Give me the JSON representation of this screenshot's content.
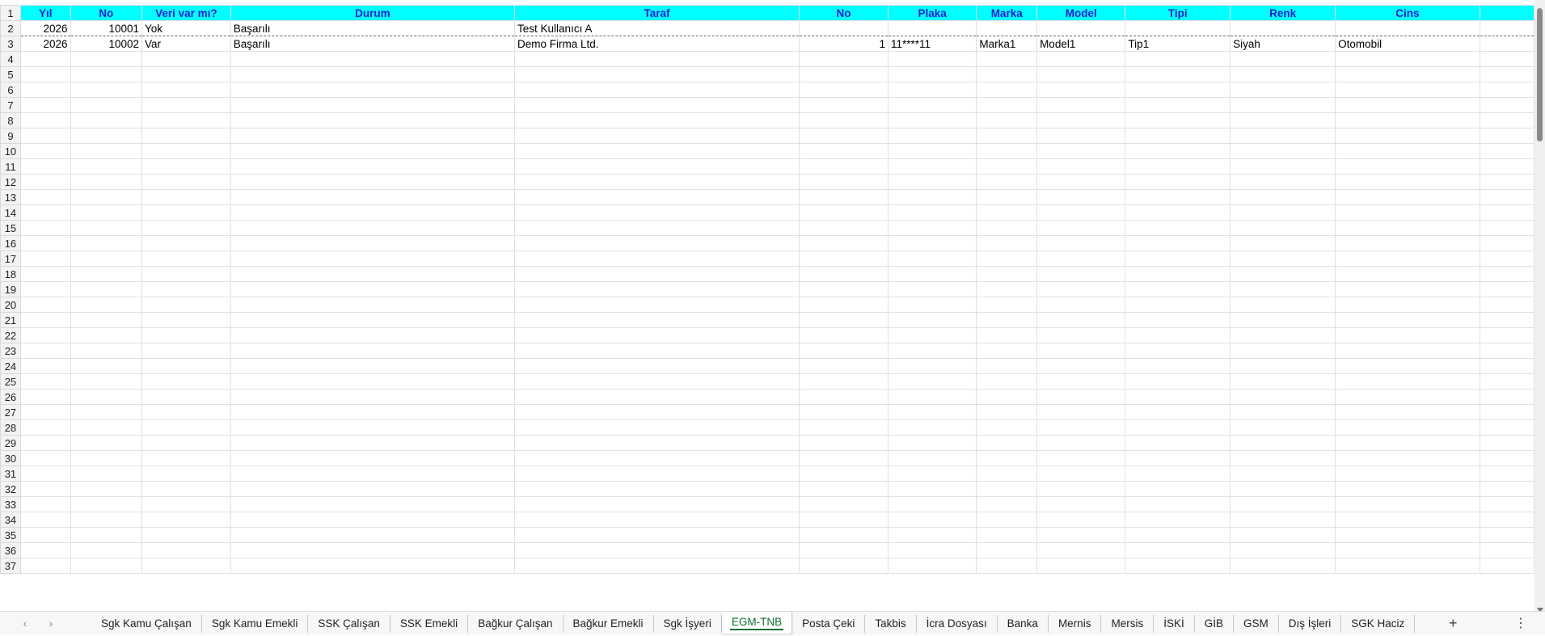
{
  "colors": {
    "header_fill": "#00ffff",
    "header_text": "#1f1fd0",
    "active_tab": "#106e30"
  },
  "sheet": {
    "headers": [
      "Yıl",
      "No",
      "Veri var mı?",
      "Durum",
      "Taraf",
      "No",
      "Plaka",
      "Marka",
      "Model",
      "Tipi",
      "Renk",
      "Cins"
    ],
    "rows": [
      [
        "2026",
        "10001",
        "Yok",
        "Başarılı",
        "Test Kullanıcı A",
        "",
        "",
        "",
        "",
        "",
        "",
        ""
      ],
      [
        "2026",
        "10002",
        "Var",
        "Başarılı",
        "Demo Firma Ltd.",
        "1",
        "11****11",
        "Marka1",
        "Model1",
        "Tip1",
        "Siyah",
        "Otomobil"
      ]
    ],
    "row_numbers": [
      "1",
      "2",
      "3",
      "4",
      "5",
      "6",
      "7",
      "8",
      "9",
      "10",
      "11",
      "12",
      "13",
      "14",
      "15",
      "16",
      "17",
      "18",
      "19",
      "20",
      "21",
      "22",
      "23",
      "24",
      "25",
      "26",
      "27",
      "28",
      "29",
      "30",
      "31",
      "32",
      "33",
      "34",
      "35",
      "36",
      "37"
    ]
  },
  "tabbar": {
    "nav_prev_icon": "chevron-left-icon",
    "nav_next_icon": "chevron-right-icon",
    "tabs": [
      "Sgk Kamu Çalışan",
      "Sgk Kamu Emekli",
      "SSK Çalışan",
      "SSK Emekli",
      "Bağkur Çalışan",
      "Bağkur Emekli",
      "Sgk İşyeri",
      "EGM-TNB",
      "Posta Çeki",
      "Takbis",
      "İcra Dosyası",
      "Banka",
      "Mernis",
      "Mersis",
      "İSKİ",
      "GİB",
      "GSM",
      "Dış İşleri",
      "SGK Haciz"
    ],
    "active_index": 7,
    "add_label": "+",
    "more_label": "⋮"
  }
}
